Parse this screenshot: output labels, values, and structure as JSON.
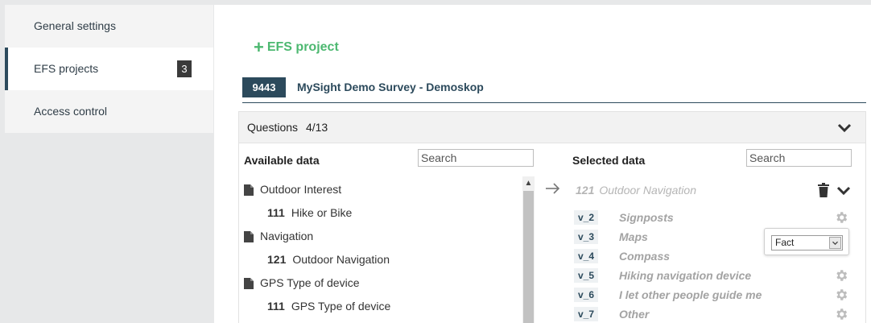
{
  "sidebar": {
    "items": [
      {
        "label": "General settings"
      },
      {
        "label": "EFS projects",
        "badge": "3"
      },
      {
        "label": "Access control"
      }
    ]
  },
  "add_project_label": "EFS project",
  "project": {
    "id": "9443",
    "name": "MySight Demo Survey - Demoskop"
  },
  "questions": {
    "label": "Questions",
    "count": "4/13"
  },
  "available": {
    "title": "Available data",
    "search_placeholder": "Search",
    "groups": [
      {
        "name": "Outdoor Interest",
        "question": {
          "num": "111",
          "label": "Hike or Bike"
        }
      },
      {
        "name": "Navigation",
        "question": {
          "num": "121",
          "label": "Outdoor Navigation"
        }
      },
      {
        "name": "GPS Type of device",
        "question": {
          "num": "111",
          "label": "GPS Type of device"
        }
      }
    ]
  },
  "selected": {
    "title": "Selected data",
    "search_placeholder": "Search",
    "question": {
      "num": "121",
      "label": "Outdoor Navigation"
    },
    "variables": [
      {
        "code": "v_2",
        "label": "Signposts"
      },
      {
        "code": "v_3",
        "label": "Maps"
      },
      {
        "code": "v_4",
        "label": "Compass"
      },
      {
        "code": "v_5",
        "label": "Hiking navigation device"
      },
      {
        "code": "v_6",
        "label": "I let other people guide me"
      },
      {
        "code": "v_7",
        "label": "Other"
      }
    ]
  },
  "popup": {
    "selected_value": "Fact"
  },
  "colors": {
    "accent_green": "#4cb870",
    "navy": "#2c4a5c"
  }
}
